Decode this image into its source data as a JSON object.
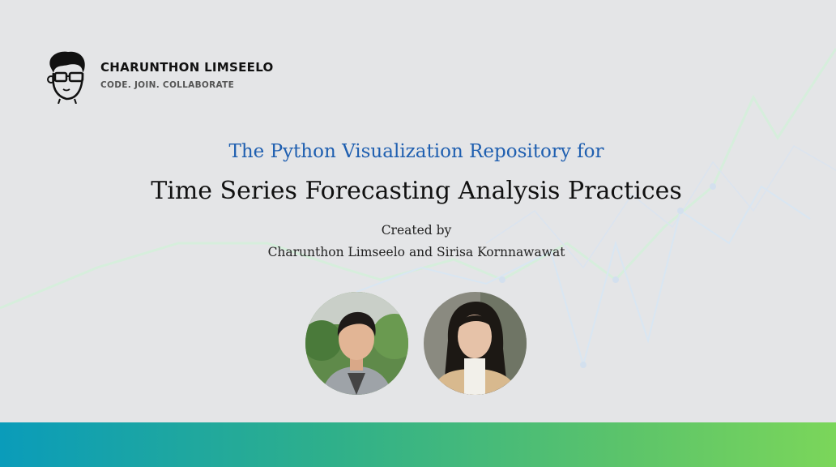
{
  "brand": {
    "name": "CHARUNTHON LIMSEELO",
    "tagline": "CODE. JOIN. COLLABORATE"
  },
  "title": {
    "line1": "The Python Visualization Repository for",
    "line2": "Time Series Forecasting Analysis Practices"
  },
  "credits": {
    "label": "Created by",
    "authors": "Charunthon Limseelo and Sirisa Kornnawawat"
  },
  "colors": {
    "title_blue": "#1f5fb0",
    "gradient_start": "#0a9cba",
    "gradient_end": "#7bd65a",
    "background": "#e4e5e7"
  }
}
